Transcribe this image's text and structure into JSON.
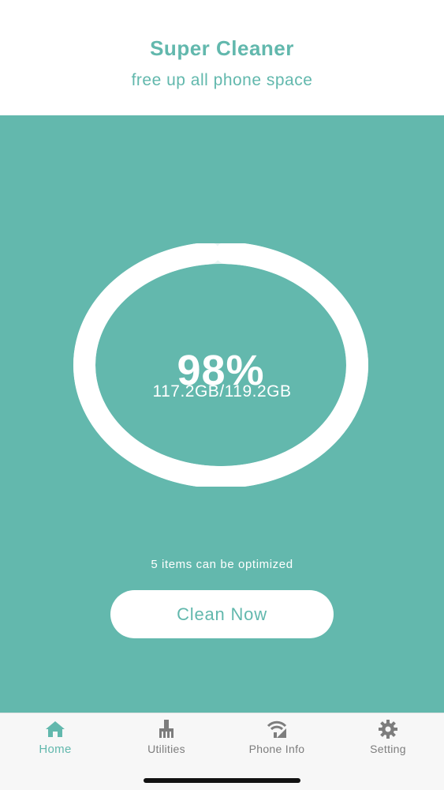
{
  "header": {
    "title": "Super Cleaner",
    "subtitle": "free up all phone space"
  },
  "storage": {
    "percent_text": "98%",
    "used_fraction": 0.98,
    "capacity_text": "117.2GB/119.2GB"
  },
  "optimize": {
    "message": "5 items can be optimized",
    "button_label": "Clean Now"
  },
  "tabs": [
    {
      "label": "Home",
      "icon": "home-icon",
      "active": true
    },
    {
      "label": "Utilities",
      "icon": "broom-icon",
      "active": false
    },
    {
      "label": "Phone Info",
      "icon": "wifi-signal-icon",
      "active": false
    },
    {
      "label": "Setting",
      "icon": "gear-icon",
      "active": false
    }
  ],
  "colors": {
    "accent": "#63b8ad",
    "background": "#ffffff",
    "tab_inactive": "#7d7d7d"
  }
}
